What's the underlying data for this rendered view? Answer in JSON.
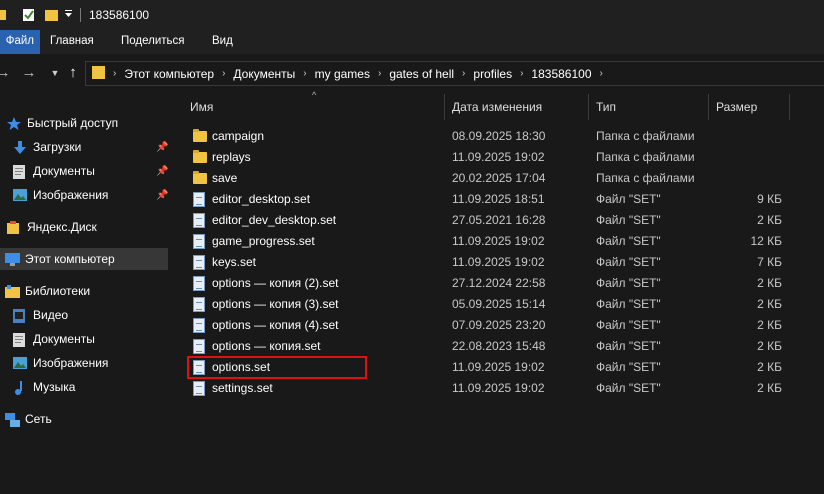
{
  "title": "183586100",
  "ribbon": {
    "tabs": [
      "Файл",
      "Главная",
      "Поделиться",
      "Вид"
    ]
  },
  "address": {
    "crumbs": [
      "Этот компьютер",
      "Документы",
      "my games",
      "gates of hell",
      "profiles",
      "183586100"
    ]
  },
  "nav": {
    "items": [
      {
        "label": "Быстрый доступ",
        "icon": "star-icon"
      },
      {
        "label": "Загрузки",
        "icon": "download-icon",
        "pinned": true
      },
      {
        "label": "Документы",
        "icon": "documents-icon",
        "pinned": true
      },
      {
        "label": "Изображения",
        "icon": "pictures-icon",
        "pinned": true
      },
      {
        "label": "Яндекс.Диск",
        "icon": "yandex-disk-icon"
      },
      {
        "label": "Этот компьютер",
        "icon": "computer-icon",
        "selected": true
      },
      {
        "label": "Библиотеки",
        "icon": "libraries-icon"
      },
      {
        "label": "Видео",
        "icon": "video-icon"
      },
      {
        "label": "Документы",
        "icon": "documents-icon"
      },
      {
        "label": "Изображения",
        "icon": "pictures-icon"
      },
      {
        "label": "Музыка",
        "icon": "music-icon"
      },
      {
        "label": "Сеть",
        "icon": "network-icon"
      }
    ]
  },
  "columns": {
    "name": "Имя",
    "date": "Дата изменения",
    "type": "Тип",
    "size": "Размер"
  },
  "files": [
    {
      "name": "campaign",
      "date": "08.09.2025 18:30",
      "type": "Папка с файлами",
      "size": "",
      "kind": "folder"
    },
    {
      "name": "replays",
      "date": "11.09.2025 19:02",
      "type": "Папка с файлами",
      "size": "",
      "kind": "folder"
    },
    {
      "name": "save",
      "date": "20.02.2025 17:04",
      "type": "Папка с файлами",
      "size": "",
      "kind": "folder"
    },
    {
      "name": "editor_desktop.set",
      "date": "11.09.2025 18:51",
      "type": "Файл \"SET\"",
      "size": "9 КБ",
      "kind": "file"
    },
    {
      "name": "editor_dev_desktop.set",
      "date": "27.05.2021 16:28",
      "type": "Файл \"SET\"",
      "size": "2 КБ",
      "kind": "file"
    },
    {
      "name": "game_progress.set",
      "date": "11.09.2025 19:02",
      "type": "Файл \"SET\"",
      "size": "12 КБ",
      "kind": "file"
    },
    {
      "name": "keys.set",
      "date": "11.09.2025 19:02",
      "type": "Файл \"SET\"",
      "size": "7 КБ",
      "kind": "file"
    },
    {
      "name": "options — копия (2).set",
      "date": "27.12.2024 22:58",
      "type": "Файл \"SET\"",
      "size": "2 КБ",
      "kind": "file"
    },
    {
      "name": "options — копия (3).set",
      "date": "05.09.2025 15:14",
      "type": "Файл \"SET\"",
      "size": "2 КБ",
      "kind": "file"
    },
    {
      "name": "options — копия (4).set",
      "date": "07.09.2025 23:20",
      "type": "Файл \"SET\"",
      "size": "2 КБ",
      "kind": "file"
    },
    {
      "name": "options — копия.set",
      "date": "22.08.2023 15:48",
      "type": "Файл \"SET\"",
      "size": "2 КБ",
      "kind": "file"
    },
    {
      "name": "options.set",
      "date": "11.09.2025 19:02",
      "type": "Файл \"SET\"",
      "size": "2 КБ",
      "kind": "file",
      "highlighted": true
    },
    {
      "name": "settings.set",
      "date": "11.09.2025 19:02",
      "type": "Файл \"SET\"",
      "size": "2 КБ",
      "kind": "file"
    }
  ],
  "colors": {
    "background": "#191919",
    "chrome": "#202020",
    "file_tab": "#2a62b0",
    "selection": "#373737",
    "highlight_box": "#e01010",
    "folder": "#f0c342"
  }
}
